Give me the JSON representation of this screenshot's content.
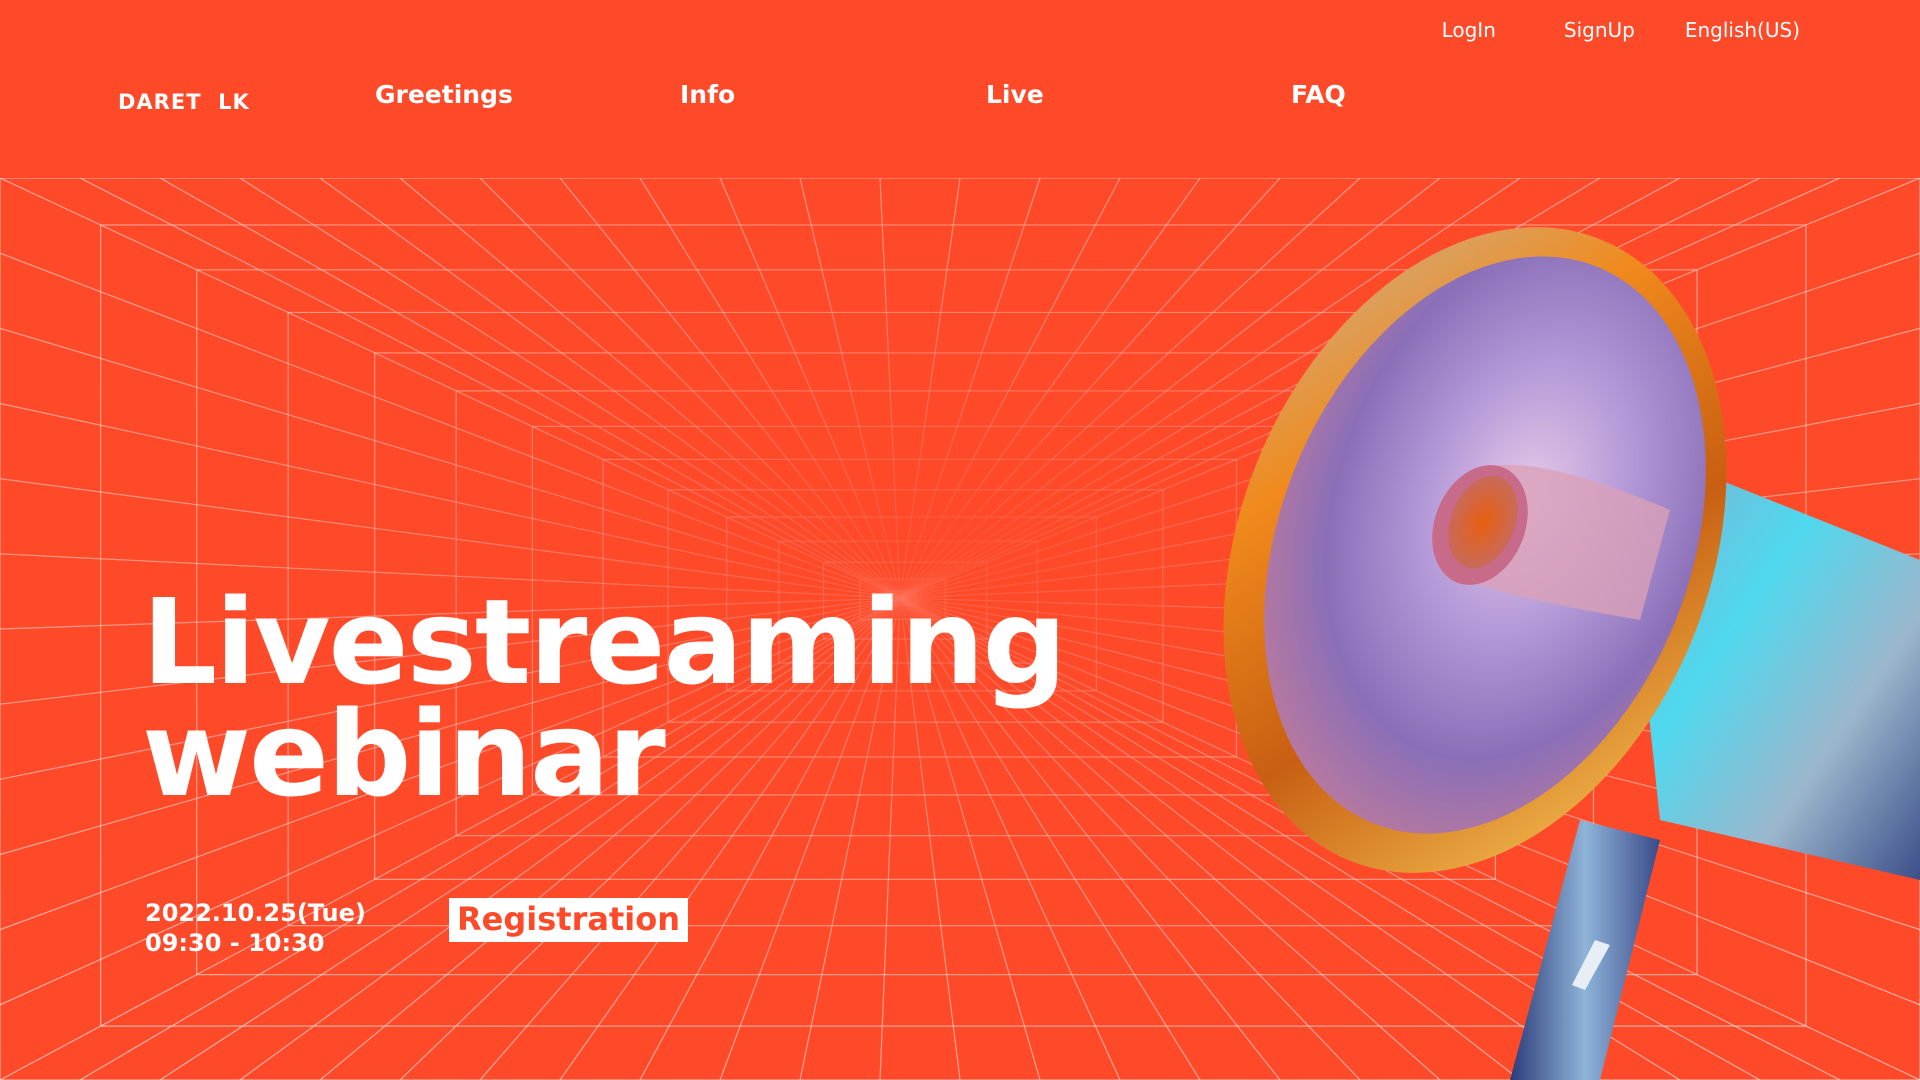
{
  "header": {
    "logo_text": "DARET  LK",
    "top_links": {
      "login": "LogIn",
      "signup": "SignUp",
      "language": "English(US)"
    },
    "nav": {
      "greetings": "Greetings",
      "info": "Info",
      "live": "Live",
      "faq": "FAQ"
    }
  },
  "hero": {
    "title_line1": "Livestreaming",
    "title_line2": "webinar",
    "date": "2022.10.25(Tue)",
    "time": "09:30 - 10:30",
    "register_label": "Registration"
  },
  "colors": {
    "background": "#ff4a2a",
    "text": "#ffffff",
    "grid": "#ffffff"
  },
  "icons": {
    "hero_image": "megaphone-icon"
  }
}
